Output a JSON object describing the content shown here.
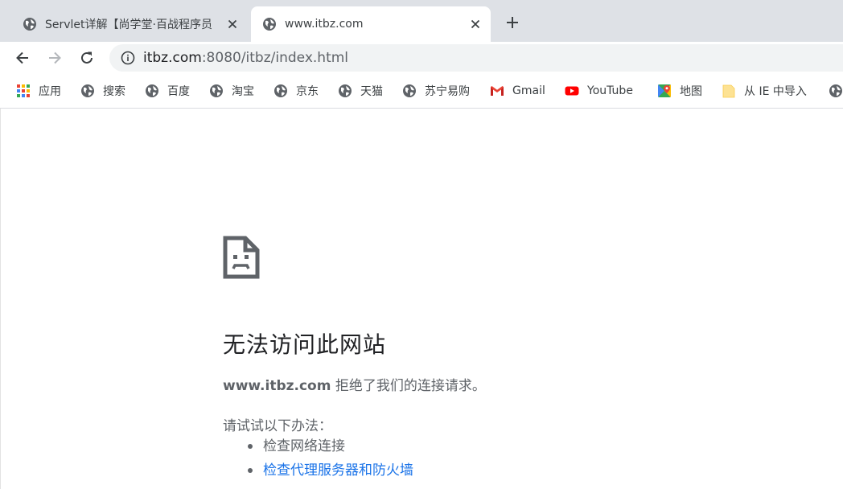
{
  "tabs": [
    {
      "title": "Servlet详解【尚学堂·百战程序员",
      "icon": "globe-icon",
      "active": false
    },
    {
      "title": "www.itbz.com",
      "icon": "globe-icon",
      "active": true
    }
  ],
  "toolbar": {
    "url_host": "itbz.com",
    "url_rest": ":8080/itbz/index.html"
  },
  "bookmarks": [
    {
      "label": "应用",
      "icon": "apps-grid-icon"
    },
    {
      "label": "搜索",
      "icon": "globe-icon"
    },
    {
      "label": "百度",
      "icon": "globe-icon"
    },
    {
      "label": "淘宝",
      "icon": "globe-icon"
    },
    {
      "label": "京东",
      "icon": "globe-icon"
    },
    {
      "label": "天猫",
      "icon": "globe-icon"
    },
    {
      "label": "苏宁易购",
      "icon": "globe-icon"
    },
    {
      "label": "Gmail",
      "icon": "gmail-icon"
    },
    {
      "label": "YouTube",
      "icon": "youtube-icon"
    },
    {
      "label": "地图",
      "icon": "maps-icon"
    },
    {
      "label": "从 IE 中导入",
      "icon": "folder-icon"
    }
  ],
  "error": {
    "title": "无法访问此网站",
    "host": "www.itbz.com",
    "message": "拒绝了我们的连接请求。",
    "suggest_label": "请试试以下办法：",
    "suggestions": [
      {
        "text": "检查网络连接",
        "link": false
      },
      {
        "text": "检查代理服务器和防火墙",
        "link": true
      }
    ]
  },
  "colors": {
    "tabstrip_bg": "#dee1e6",
    "omnibox_bg": "#f1f3f4",
    "link": "#1a73e8",
    "text_secondary": "#5f6368"
  }
}
